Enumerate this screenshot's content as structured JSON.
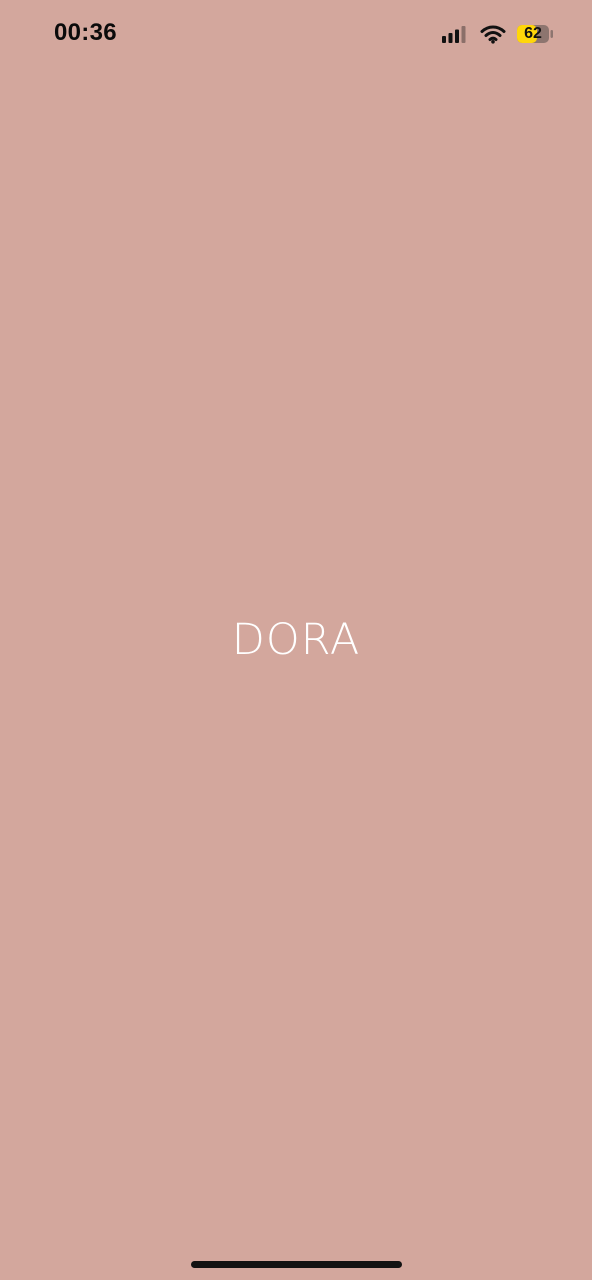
{
  "status_bar": {
    "time": "00:36",
    "battery_level": "62",
    "signal_icon": "cellular-signal-icon",
    "wifi_icon": "wifi-icon",
    "battery_icon": "battery-icon",
    "battery_color": "#ffd60a"
  },
  "splash": {
    "brand": "DORA",
    "background_color": "#d3a79d",
    "brand_color": "#ffffff"
  }
}
